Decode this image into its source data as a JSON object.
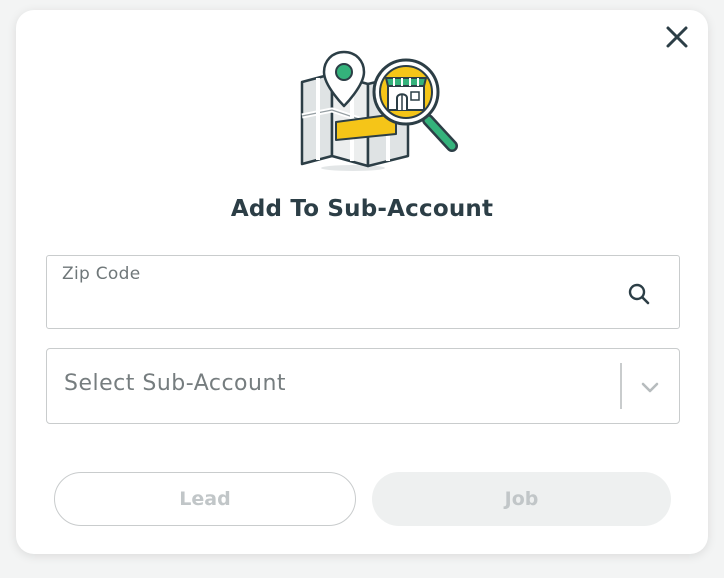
{
  "dialog": {
    "title": "Add To Sub-Account",
    "close_icon": "close-icon",
    "illustration_icon": "map-store-search-illustration"
  },
  "zip_field": {
    "label": "Zip Code",
    "value": "",
    "placeholder": "",
    "icon": "search-icon"
  },
  "sub_account_select": {
    "selected": "Select Sub-Account",
    "icon": "chevron-down-icon"
  },
  "buttons": {
    "lead_label": "Lead",
    "job_label": "Job"
  },
  "colors": {
    "title": "#2c3e46",
    "accent_green": "#34b27b",
    "accent_yellow": "#f5c518",
    "disabled_text": "#c1c6c8"
  }
}
